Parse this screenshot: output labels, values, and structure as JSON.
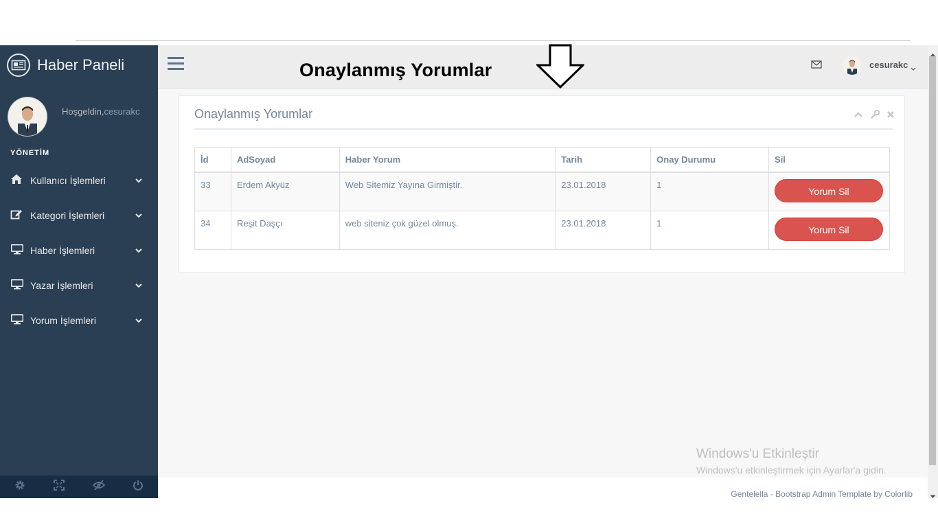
{
  "sidebar": {
    "brand": "Haber Paneli",
    "welcome": "Hoşgeldin,",
    "username": "cesurakc",
    "section": "YÖNETİM",
    "items": [
      {
        "label": "Kullanıcı İşlemleri",
        "icon": "home-icon"
      },
      {
        "label": "Kategori İşlemleri",
        "icon": "edit-icon"
      },
      {
        "label": "Haber İşlemleri",
        "icon": "desktop-icon"
      },
      {
        "label": "Yazar İşlemleri",
        "icon": "desktop-icon"
      },
      {
        "label": "Yorum İşlemleri",
        "icon": "desktop-icon"
      }
    ],
    "footer_icons": [
      "gear-icon",
      "fullscreen-icon",
      "eye-slash-icon",
      "power-icon"
    ]
  },
  "topnav": {
    "username": "cesurakc"
  },
  "annotation": {
    "title": "Onaylanmış Yorumlar"
  },
  "panel": {
    "title": "Onaylanmış Yorumlar",
    "tools": [
      "chevron-up-icon",
      "wrench-icon",
      "close-icon"
    ]
  },
  "table": {
    "headers": [
      "İd",
      "AdSoyad",
      "Haber Yorum",
      "Tarih",
      "Onay Durumu",
      "Sil"
    ],
    "rows": [
      {
        "id": "33",
        "name": "Erdem Akyüz",
        "comment": "Web Sitemiz Yayına Girmiştir.",
        "date": "23.01.2018",
        "status": "1",
        "button": "Yorum Sil"
      },
      {
        "id": "34",
        "name": "Reşit Daşçı",
        "comment": "web siteniz çok güzel olmuş.",
        "date": "23.01.2018",
        "status": "1",
        "button": "Yorum Sil"
      }
    ]
  },
  "watermark": {
    "line1": "Windows'u Etkinleştir",
    "line2": "Windows'u etkinleştirmek için Ayarlar'a gidin."
  },
  "footer": {
    "text": "Gentelella - Bootstrap Admin Template by Colorlib"
  },
  "colors": {
    "sidebar": "#2a3f54",
    "danger": "#d9534f",
    "text": "#73879c"
  }
}
